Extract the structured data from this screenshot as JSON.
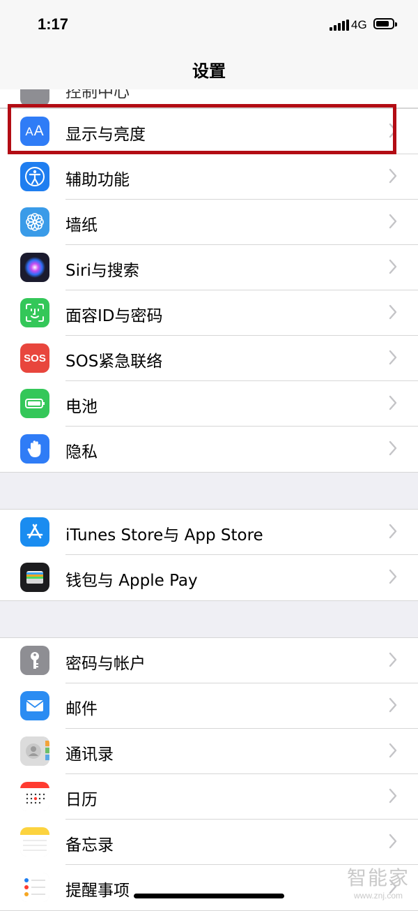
{
  "status_bar": {
    "time": "1:17",
    "network": "4G",
    "battery_level": 0.8
  },
  "nav": {
    "title": "设置"
  },
  "top_partial_item": {
    "label": "控制中心"
  },
  "groups": [
    {
      "items": [
        {
          "label": "显示与亮度",
          "icon": "display-brightness-icon",
          "color": "#2f7cf6",
          "highlighted": true
        },
        {
          "label": "辅助功能",
          "icon": "accessibility-icon",
          "color": "#1f7ef0"
        },
        {
          "label": "墙纸",
          "icon": "wallpaper-icon",
          "color": "#3a9be8"
        },
        {
          "label": "Siri与搜索",
          "icon": "siri-icon",
          "color": "#1b1b2e"
        },
        {
          "label": "面容ID与密码",
          "icon": "face-id-icon",
          "color": "#34c759"
        },
        {
          "label": "SOS紧急联络",
          "icon": "sos-icon",
          "color": "#e8463d",
          "icon_text": "SOS"
        },
        {
          "label": "电池",
          "icon": "battery-icon",
          "color": "#34c759"
        },
        {
          "label": "隐私",
          "icon": "privacy-hand-icon",
          "color": "#2f7cf6"
        }
      ]
    },
    {
      "items": [
        {
          "label": "iTunes Store与 App Store",
          "icon": "app-store-icon",
          "color": "#1a8cf0"
        },
        {
          "label": "钱包与 Apple Pay",
          "icon": "wallet-icon",
          "color": "#1c1c1e"
        }
      ]
    },
    {
      "items": [
        {
          "label": "密码与帐户",
          "icon": "key-icon",
          "color": "#8e8e93"
        },
        {
          "label": "邮件",
          "icon": "mail-icon",
          "color": "#2b8cf2"
        },
        {
          "label": "通讯录",
          "icon": "contacts-icon",
          "color": "#d8d8d8"
        },
        {
          "label": "日历",
          "icon": "calendar-icon",
          "color": "#ffffff"
        },
        {
          "label": "备忘录",
          "icon": "notes-icon",
          "color": "#ffffff"
        },
        {
          "label": "提醒事项",
          "icon": "reminders-icon",
          "color": "#ffffff"
        }
      ]
    }
  ],
  "watermark": {
    "text": "智能家",
    "url": "www.znj.com"
  }
}
